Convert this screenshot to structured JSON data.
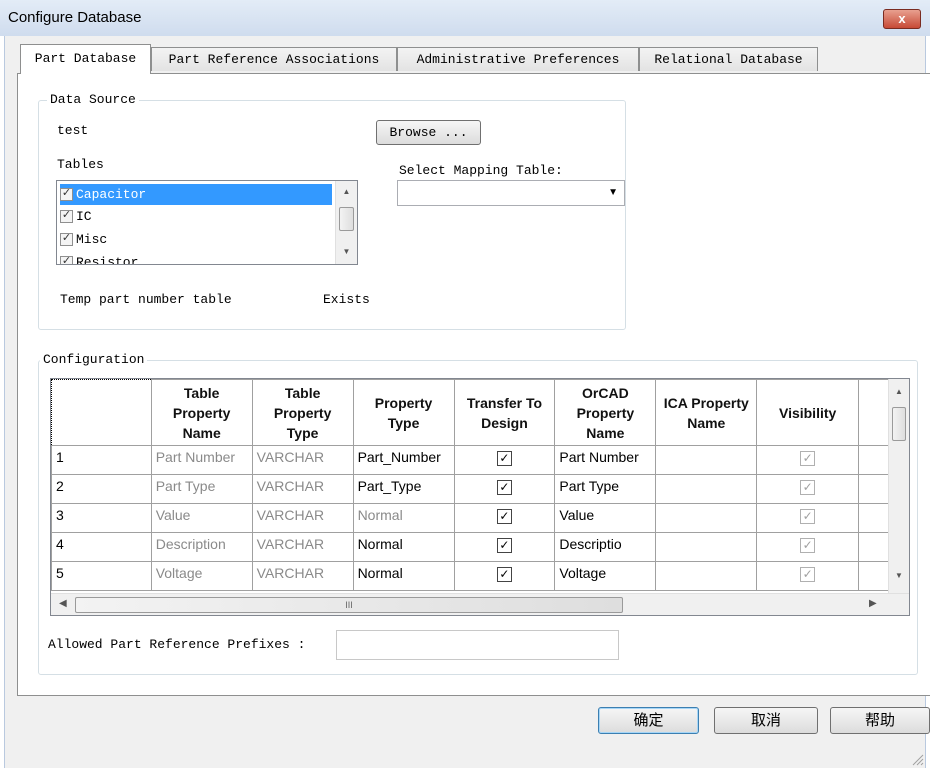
{
  "window": {
    "title": "Configure Database",
    "close_glyph": "x"
  },
  "tabs": [
    {
      "label": "Part Database",
      "active": true
    },
    {
      "label": "Part Reference Associations",
      "active": false
    },
    {
      "label": "Administrative Preferences",
      "active": false
    },
    {
      "label": "Relational Database",
      "active": false
    }
  ],
  "data_source": {
    "legend": "Data Source",
    "source_name": "test",
    "browse_label": "Browse ...",
    "tables_label": "Tables",
    "tables": [
      {
        "name": "Capacitor",
        "checked": true,
        "selected": true
      },
      {
        "name": "IC",
        "checked": true,
        "selected": false
      },
      {
        "name": "Misc",
        "checked": true,
        "selected": false
      },
      {
        "name": "Resistor",
        "checked": true,
        "selected": false
      }
    ],
    "mapping_label": "Select Mapping Table:",
    "mapping_value": "",
    "temp_label": "Temp part number table",
    "temp_status": "Exists"
  },
  "configuration": {
    "legend": "Configuration",
    "columns": [
      "",
      "Table Property Name",
      "Table Property Type",
      "Property Type",
      "Transfer To Design",
      "OrCAD Property Name",
      "ICA Property Name",
      "Visibility"
    ],
    "rows": [
      {
        "num": "1",
        "table_prop": "Part Number",
        "type": "VARCHAR",
        "prop_type": "Part_Number",
        "prop_type_gray": false,
        "transfer": true,
        "orcad": "Part Number",
        "ica": "",
        "visible": true
      },
      {
        "num": "2",
        "table_prop": "Part Type",
        "type": "VARCHAR",
        "prop_type": "Part_Type",
        "prop_type_gray": false,
        "transfer": true,
        "orcad": "Part Type",
        "ica": "",
        "visible": true
      },
      {
        "num": "3",
        "table_prop": "Value",
        "type": "VARCHAR",
        "prop_type": "Normal",
        "prop_type_gray": true,
        "transfer": true,
        "orcad": "Value",
        "ica": "",
        "visible": true
      },
      {
        "num": "4",
        "table_prop": "Description",
        "type": "VARCHAR",
        "prop_type": "Normal",
        "prop_type_gray": false,
        "transfer": true,
        "orcad": "Descriptio",
        "ica": "",
        "visible": true
      },
      {
        "num": "5",
        "table_prop": "Voltage",
        "type": "VARCHAR",
        "prop_type": "Normal",
        "prop_type_gray": false,
        "transfer": true,
        "orcad": "Voltage",
        "ica": "",
        "visible": true
      }
    ],
    "hscroll_grip": "III",
    "prefixes_label": "Allowed Part Reference Prefixes :",
    "prefixes_value": ""
  },
  "buttons": {
    "ok": "确定",
    "cancel": "取消",
    "help": "帮助"
  }
}
